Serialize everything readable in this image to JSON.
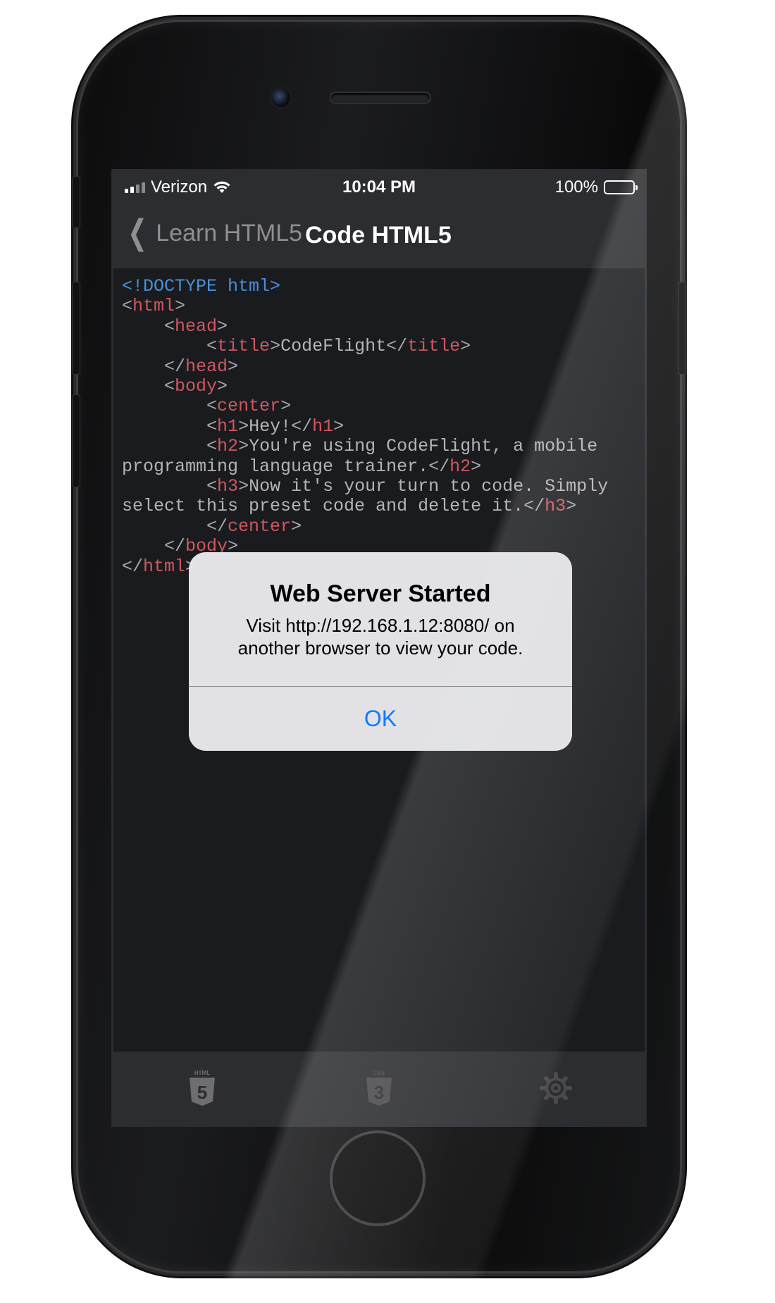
{
  "status_bar": {
    "carrier": "Verizon",
    "time": "10:04 PM",
    "battery": "100%"
  },
  "nav": {
    "back_label": "Learn HTML5",
    "title": "Code HTML5"
  },
  "editor": {
    "lines": [
      [
        [
          "doc",
          "<!DOCTYPE html>"
        ]
      ],
      [
        [
          "pun",
          "<"
        ],
        [
          "tag",
          "html"
        ],
        [
          "pun",
          ">"
        ]
      ],
      [
        [
          "txt",
          "    "
        ],
        [
          "pun",
          "<"
        ],
        [
          "tag",
          "head"
        ],
        [
          "pun",
          ">"
        ]
      ],
      [
        [
          "txt",
          "        "
        ],
        [
          "pun",
          "<"
        ],
        [
          "tag",
          "title"
        ],
        [
          "pun",
          ">"
        ],
        [
          "txt",
          "CodeFlight"
        ],
        [
          "pun",
          "</"
        ],
        [
          "tag",
          "title"
        ],
        [
          "pun",
          ">"
        ]
      ],
      [
        [
          "txt",
          "    "
        ],
        [
          "pun",
          "</"
        ],
        [
          "tag",
          "head"
        ],
        [
          "pun",
          ">"
        ]
      ],
      [
        [
          "txt",
          "    "
        ],
        [
          "pun",
          "<"
        ],
        [
          "tag",
          "body"
        ],
        [
          "pun",
          ">"
        ]
      ],
      [
        [
          "txt",
          "        "
        ],
        [
          "pun",
          "<"
        ],
        [
          "tag",
          "center"
        ],
        [
          "pun",
          ">"
        ]
      ],
      [
        [
          "txt",
          "        "
        ],
        [
          "pun",
          "<"
        ],
        [
          "tag",
          "h1"
        ],
        [
          "pun",
          ">"
        ],
        [
          "txt",
          "Hey!"
        ],
        [
          "pun",
          "</"
        ],
        [
          "tag",
          "h1"
        ],
        [
          "pun",
          ">"
        ]
      ],
      [
        [
          "txt",
          "        "
        ],
        [
          "pun",
          "<"
        ],
        [
          "tag",
          "h2"
        ],
        [
          "pun",
          ">"
        ],
        [
          "txt",
          "You're using CodeFlight, a mobile programming language trainer."
        ],
        [
          "pun",
          "</"
        ],
        [
          "tag",
          "h2"
        ],
        [
          "pun",
          ">"
        ]
      ],
      [
        [
          "txt",
          "        "
        ],
        [
          "pun",
          "<"
        ],
        [
          "tag",
          "h3"
        ],
        [
          "pun",
          ">"
        ],
        [
          "txt",
          "Now it's your turn to code. Simply select this preset code and delete it."
        ],
        [
          "pun",
          "</"
        ],
        [
          "tag",
          "h3"
        ],
        [
          "pun",
          ">"
        ]
      ],
      [
        [
          "txt",
          "        "
        ],
        [
          "pun",
          "</"
        ],
        [
          "tag",
          "center"
        ],
        [
          "pun",
          ">"
        ]
      ],
      [
        [
          "txt",
          "    "
        ],
        [
          "pun",
          "</"
        ],
        [
          "tag",
          "body"
        ],
        [
          "pun",
          ">"
        ]
      ],
      [
        [
          "pun",
          "</"
        ],
        [
          "tag",
          "html"
        ],
        [
          "pun",
          ">"
        ]
      ]
    ]
  },
  "tab_bar": {
    "items": [
      {
        "name": "html5-tab",
        "icon": "html5-icon",
        "caption": "HTML",
        "digit": "5"
      },
      {
        "name": "css3-tab",
        "icon": "css3-icon",
        "caption": "CSS",
        "digit": "3"
      },
      {
        "name": "settings-tab",
        "icon": "gear-icon"
      }
    ]
  },
  "alert": {
    "title": "Web Server Started",
    "message": "Visit http://192.168.1.12:8080/ on another browser to view your code.",
    "ok_label": "OK"
  },
  "colors": {
    "screen_bg": "#1a1b1e",
    "bar_bg": "#2c2d30",
    "code_text": "#b4b4b8",
    "code_tag": "#d0575f",
    "code_doctype": "#4a90d9",
    "alert_button": "#0a7cff"
  }
}
